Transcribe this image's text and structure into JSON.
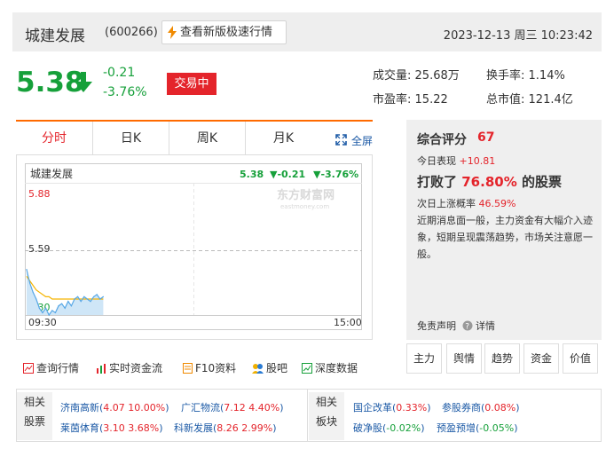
{
  "header": {
    "stock_name": "城建发展",
    "stock_code": "(600266)",
    "fast_quote_label": "查看新版极速行情",
    "datetime": "2023-12-13 周三 10:23:42"
  },
  "quote": {
    "price": "5.38",
    "change_abs": "-0.21",
    "change_pct": "-3.76%",
    "status_badge": "交易中",
    "direction": "down",
    "color": "#16a03a"
  },
  "stats": {
    "volume_label": "成交量:",
    "volume_value": "25.68万",
    "turnover_label": "换手率:",
    "turnover_value": "1.14%",
    "pe_label": "市盈率:",
    "pe_value": "15.22",
    "mcap_label": "总市值:",
    "mcap_value": "121.4亿"
  },
  "chart_tabs": [
    "分时",
    "日K",
    "周K",
    "月K"
  ],
  "fullscreen_label": "全屏",
  "chart": {
    "title": "城建发展",
    "last": "5.38",
    "change_abs": "▼-0.21",
    "change_pct": "▼-3.76%",
    "y_top": "5.88",
    "y_mid": "5.59",
    "y_low": "5.30",
    "x_start": "09:30",
    "x_end": "15:00",
    "watermark_cn": "东方财富网",
    "watermark_en": "eastmoney.com"
  },
  "chart_data": {
    "type": "line",
    "ylim": [
      5.3,
      5.88
    ],
    "prev_close": 5.59,
    "series": [
      {
        "values": [
          5.5,
          5.44,
          5.4,
          5.37,
          5.33,
          5.31,
          5.33,
          5.3,
          5.32,
          5.31,
          5.34,
          5.35,
          5.33,
          5.36,
          5.34,
          5.37,
          5.38,
          5.36,
          5.38,
          5.37,
          5.36,
          5.38,
          5.39,
          5.37,
          5.38
        ]
      },
      {
        "values": [
          5.47,
          5.45,
          5.43,
          5.41,
          5.4,
          5.39,
          5.38,
          5.38,
          5.37,
          5.37,
          5.37,
          5.37,
          5.37,
          5.37,
          5.37,
          5.37,
          5.37,
          5.37,
          5.37,
          5.37,
          5.37,
          5.37,
          5.37,
          5.37,
          5.37
        ]
      }
    ],
    "colors": {
      "price": "#56a7e6",
      "avg": "#f5b400",
      "fill": "#cfe6f7"
    }
  },
  "links": [
    "查询行情",
    "实时资金流",
    "F10资料",
    "股吧",
    "深度数据"
  ],
  "panel": {
    "title": "综合评分",
    "score": "67",
    "today_label": "今日表现",
    "today_value": "+10.81",
    "beat_prefix": "打败了",
    "beat_pct": "76.80%",
    "beat_suffix": "的股票",
    "next_label": "次日上涨概率",
    "next_value": "46.59%",
    "description": "近期消息面一般，主力资金有大幅介入迹象，短期呈现震荡趋势，市场关注意愿一般。",
    "disclaimer": "免责声明",
    "details": "详情"
  },
  "panel_buttons": [
    "主力",
    "舆情",
    "趋势",
    "资金",
    "价值"
  ],
  "related_stocks": {
    "label_line1": "相关",
    "label_line2": "股票",
    "items": [
      {
        "name": "济南高新",
        "value": "4.07 10.00%"
      },
      {
        "name": "广汇物流",
        "value": "7.12 4.40%"
      },
      {
        "name": "莱茵体育",
        "value": "3.10 3.68%"
      },
      {
        "name": "科新发展",
        "value": "8.26 2.99%"
      }
    ]
  },
  "related_sectors": {
    "label_line1": "相关",
    "label_line2": "板块",
    "items": [
      {
        "name": "国企改革",
        "value": "0.33%"
      },
      {
        "name": "参股券商",
        "value": "0.08%"
      },
      {
        "name": "破净股",
        "value": "-0.02%"
      },
      {
        "name": "预盈预增",
        "value": "-0.05%"
      }
    ]
  }
}
